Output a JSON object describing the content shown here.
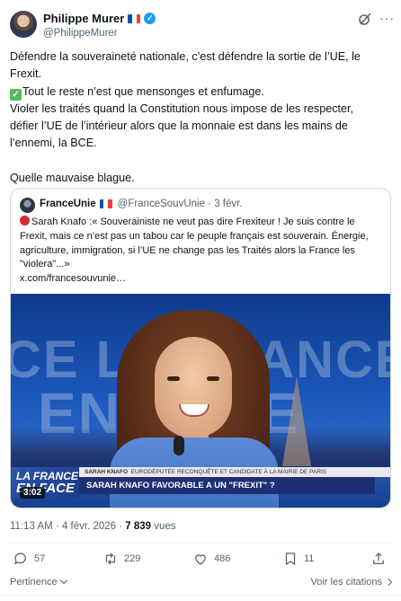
{
  "author": {
    "name": "Philippe Murer",
    "handle": "@PhilippeMurer"
  },
  "header_icons": [
    "grok-icon",
    "more-icon"
  ],
  "tweet": {
    "lines": [
      "Défendre la souveraineté nationale, c’est défendre la sortie de l’UE, le",
      "Frexit.",
      "Tout le reste n’est que mensonges et enfumage.",
      "Violer les traités quand la Constitution nous impose de les respecter,",
      "défier l’UE de l’intérieur alors que la monnaie est dans les mains de",
      "l’ennemi, la BCE.",
      "",
      "Quelle mauvaise blague."
    ]
  },
  "quote": {
    "name": "FranceUnie",
    "handle": "@FranceSouvUnie · 3 févr.",
    "lines": [
      "Sarah Knafo :« Souverainiste ne veut pas dire Frexiteur ! Je suis contre le",
      "Frexit, mais ce n’est pas un tabou car le peuple français est souverain. Énergie,",
      "agriculture, immigration, si l’UE ne change pas les Traités alors la France les",
      "\"violera\"...»",
      "x.com/francesouvunie…"
    ],
    "media": {
      "bg_text_1": "CE LA FRANCE LA FRANCE",
      "bg_text_2": "EN FACE",
      "logo_line1": "LA FRANCE",
      "logo_line2": "EN FACE",
      "caption_top_name": "SARAH KNAFO",
      "caption_top_rest": "EURODÉPUTÉE RECONQUÊTE ET CANDIDATE À LA MAIRIE DE PARIS",
      "caption_main": "SARAH KNAFO FAVORABLE A UN \"FREXIT\" ?",
      "duration": "3:02"
    }
  },
  "meta": {
    "time_date": "11:13 AM · 4 févr. 2026 · ",
    "views_count": "7 839",
    "views_label": " vues"
  },
  "actions": {
    "replies": "57",
    "reposts": "229",
    "likes": "486",
    "bookmarks": "11"
  },
  "footer": {
    "sort_label": "Pertinence",
    "quotes_label": "Voir les citations"
  },
  "colors": {
    "verified": "#1d9bf0",
    "secondary_text": "#536471",
    "border": "#cfd9de",
    "flag_blue": "#0055a4",
    "flag_red": "#ef4135"
  }
}
